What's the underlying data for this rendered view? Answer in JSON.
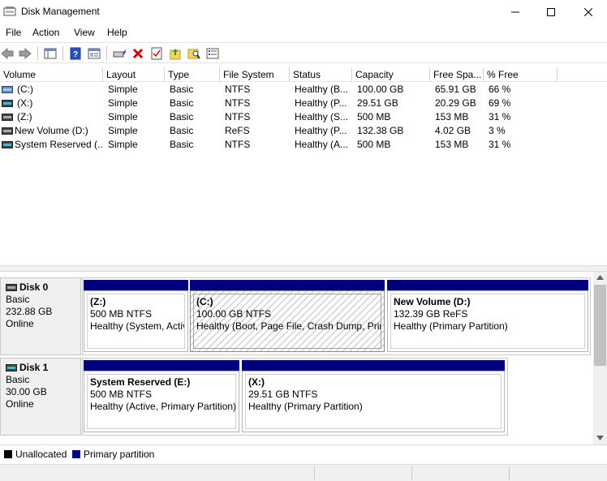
{
  "window": {
    "title": "Disk Management"
  },
  "menu": [
    "File",
    "Action",
    "View",
    "Help"
  ],
  "volume_list": {
    "columns": [
      "Volume",
      "Layout",
      "Type",
      "File System",
      "Status",
      "Capacity",
      "Free Spa...",
      "% Free"
    ],
    "rows": [
      {
        "volume": "(C:)",
        "layout": "Simple",
        "type": "Basic",
        "fs": "NTFS",
        "status": "Healthy (B...",
        "capacity": "100.00 GB",
        "free": "65.91 GB",
        "pct": "66 %"
      },
      {
        "volume": "(X:)",
        "layout": "Simple",
        "type": "Basic",
        "fs": "NTFS",
        "status": "Healthy (P...",
        "capacity": "29.51 GB",
        "free": "20.29 GB",
        "pct": "69 %"
      },
      {
        "volume": "(Z:)",
        "layout": "Simple",
        "type": "Basic",
        "fs": "NTFS",
        "status": "Healthy (S...",
        "capacity": "500 MB",
        "free": "153 MB",
        "pct": "31 %"
      },
      {
        "volume": "New Volume (D:)",
        "layout": "Simple",
        "type": "Basic",
        "fs": "ReFS",
        "status": "Healthy (P...",
        "capacity": "132.38 GB",
        "free": "4.02 GB",
        "pct": "3 %"
      },
      {
        "volume": "System Reserved (...",
        "layout": "Simple",
        "type": "Basic",
        "fs": "NTFS",
        "status": "Healthy (A...",
        "capacity": "500 MB",
        "free": "153 MB",
        "pct": "31 %"
      }
    ]
  },
  "disks": [
    {
      "name": "Disk 0",
      "type": "Basic",
      "size": "232.88 GB",
      "state": "Online",
      "partitions": [
        {
          "name": "(Z:)",
          "size": "500 MB NTFS",
          "status": "Healthy (System, Active, Primary Partition)"
        },
        {
          "name": "(C:)",
          "size": "100.00 GB NTFS",
          "status": "Healthy (Boot, Page File, Crash Dump, Primary Partition)"
        },
        {
          "name": "New Volume  (D:)",
          "size": "132.39 GB ReFS",
          "status": "Healthy (Primary Partition)"
        }
      ]
    },
    {
      "name": "Disk 1",
      "type": "Basic",
      "size": "30.00 GB",
      "state": "Online",
      "partitions": [
        {
          "name": "System Reserved  (E:)",
          "size": "500 MB NTFS",
          "status": "Healthy (Active, Primary Partition)"
        },
        {
          "name": "(X:)",
          "size": "29.51 GB NTFS",
          "status": "Healthy (Primary Partition)"
        }
      ]
    }
  ],
  "legend": [
    "Unallocated",
    "Primary partition"
  ],
  "colors": {
    "primary_partition": "#00007f",
    "unallocated": "#000000"
  }
}
